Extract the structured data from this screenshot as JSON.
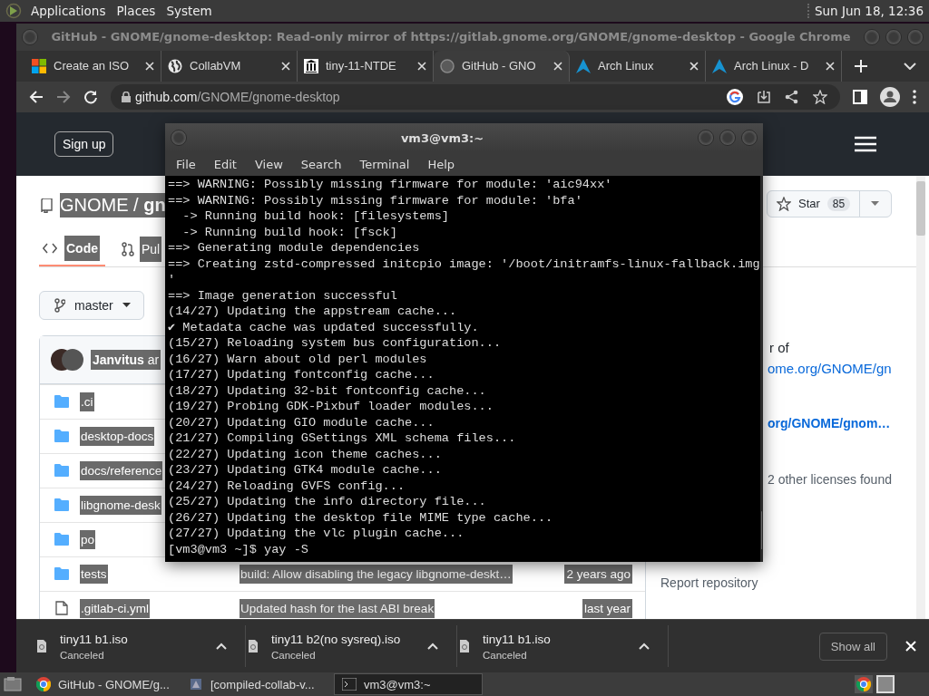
{
  "top_panel": {
    "menus": [
      "Applications",
      "Places",
      "System"
    ],
    "clock": "Sun Jun 18, 12:36"
  },
  "browser": {
    "title": "GitHub - GNOME/gnome-desktop: Read-only mirror of https://gitlab.gnome.org/GNOME/gnome-desktop - Google Chrome",
    "tabs": [
      {
        "label": "Create an ISO",
        "kind": "windows",
        "selected": false
      },
      {
        "label": "CollabVM",
        "kind": "globe",
        "selected": false
      },
      {
        "label": "tiny-11-NTDE",
        "kind": "building",
        "selected": false
      },
      {
        "label": "GitHub - GNO",
        "kind": "github",
        "selected": true
      },
      {
        "label": "Arch Linux",
        "kind": "arch",
        "selected": false
      },
      {
        "label": "Arch Linux - D",
        "kind": "arch",
        "selected": false
      }
    ],
    "address": {
      "host": "github.com",
      "path": "/GNOME/gnome-desktop"
    }
  },
  "page": {
    "selection_active": true,
    "sign_up": "Sign up",
    "repo": {
      "owner": "GNOME",
      "separator": "/",
      "name": "gn"
    },
    "tabs": [
      {
        "label": "Code",
        "kind": "code",
        "selected": true
      },
      {
        "label": "Pul",
        "kind": "pull-request",
        "selected": false
      }
    ],
    "branch": "master",
    "commit_authors": "**Janvitus** ar",
    "files": [
      {
        "kind": "folder",
        "name": ".ci"
      },
      {
        "kind": "folder",
        "name": "desktop-docs"
      },
      {
        "kind": "folder",
        "name": "docs/reference"
      },
      {
        "kind": "folder",
        "name": "libgnome-desk"
      },
      {
        "kind": "folder",
        "name": "po"
      },
      {
        "kind": "folder",
        "name": "tests",
        "message": "build: Allow disabling the legacy libgnome-deskt…",
        "date": "2 years ago"
      },
      {
        "kind": "file",
        "name": ".gitlab-ci.yml",
        "message": "Updated hash for the last ABI break",
        "date": "last year"
      }
    ],
    "star": {
      "label": "Star",
      "count": "85"
    },
    "about": {
      "text": "r of",
      "link": "ome.org/GNOME/gn",
      "website": "org/GNOME/gnom…",
      "licenses": "2 other licenses found",
      "report": "Report repository"
    }
  },
  "terminal": {
    "title": "vm3@vm3:~",
    "menus": [
      "File",
      "Edit",
      "View",
      "Search",
      "Terminal",
      "Help"
    ],
    "lines": [
      "==> WARNING: Possibly missing firmware for module: 'aic94xx'",
      "==> WARNING: Possibly missing firmware for module: 'bfa'",
      "  -> Running build hook: [filesystems]",
      "  -> Running build hook: [fsck]",
      "==> Generating module dependencies",
      "==> Creating zstd-compressed initcpio image: '/boot/initramfs-linux-fallback.img",
      "'",
      "==> Image generation successful",
      "(14/27) Updating the appstream cache...",
      "✔ Metadata cache was updated successfully.",
      "(15/27) Reloading system bus configuration...",
      "(16/27) Warn about old perl modules",
      "(17/27) Updating fontconfig cache...",
      "(18/27) Updating 32-bit fontconfig cache...",
      "(19/27) Probing GDK-Pixbuf loader modules...",
      "(20/27) Updating GIO module cache...",
      "(21/27) Compiling GSettings XML schema files...",
      "(22/27) Updating icon theme caches...",
      "(23/27) Updating GTK4 module cache...",
      "(24/27) Reloading GVFS config...",
      "(25/27) Updating the info directory file...",
      "(26/27) Updating the desktop file MIME type cache...",
      "(27/27) Updating the vlc plugin cache...",
      "[vm3@vm3 ~]$ yay -S"
    ]
  },
  "downloads": {
    "items": [
      {
        "name": "tiny11 b1.iso",
        "status": "Canceled"
      },
      {
        "name": "tiny11 b2(no sysreq).iso",
        "status": "Canceled"
      },
      {
        "name": "tiny11 b1.iso",
        "status": "Canceled"
      }
    ],
    "show_all": "Show all"
  },
  "taskbar": {
    "items": [
      {
        "label": "GitHub - GNOME/g...",
        "kind": "chrome",
        "selected": false
      },
      {
        "label": "[compiled-collab-v...",
        "kind": "app",
        "selected": false
      },
      {
        "label": "vm3@vm3:~",
        "kind": "terminal",
        "selected": true
      }
    ]
  }
}
